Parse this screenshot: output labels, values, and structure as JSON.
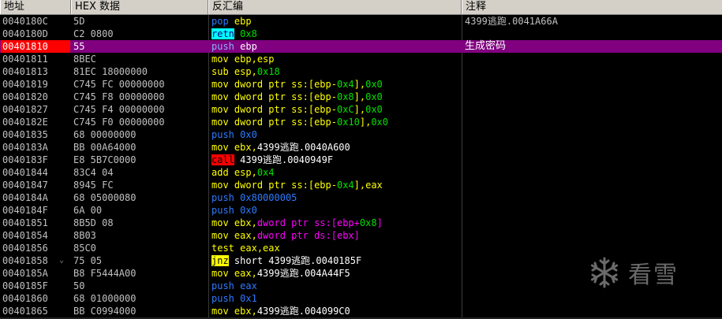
{
  "header": {
    "address": "地址",
    "hex": "HEX 数据",
    "disassembly": "反汇编",
    "comment": "注释"
  },
  "rows": [
    {
      "addr": "0040180C",
      "hex": "5D",
      "mn": "pop",
      "ops": [
        {
          "t": "ebp",
          "c": "op-y"
        }
      ],
      "cmt": "4399逃跑.0041A66A"
    },
    {
      "addr": "0040180D",
      "hex": "C2 0800",
      "mn": "retn",
      "ops": [
        {
          "t": "0x8",
          "c": "op-g"
        }
      ],
      "cmt": ""
    },
    {
      "addr": "00401810",
      "hex": "55",
      "mn": "push",
      "ops": [
        {
          "t": "ebp",
          "c": "op-w"
        }
      ],
      "cmt": "生成密码"
    },
    {
      "addr": "00401811",
      "hex": "8BEC",
      "mn": "mov",
      "ops": [
        {
          "t": "ebp,esp",
          "c": "op-y"
        }
      ],
      "cmt": ""
    },
    {
      "addr": "00401813",
      "hex": "81EC 18000000",
      "mn": "sub",
      "ops": [
        {
          "t": "esp,",
          "c": "op-y"
        },
        {
          "t": "0x18",
          "c": "op-g"
        }
      ],
      "cmt": ""
    },
    {
      "addr": "00401819",
      "hex": "C745 FC 00000000",
      "mn": "mov",
      "ops": [
        {
          "t": "dword ptr ss:[ebp-",
          "c": "op-y"
        },
        {
          "t": "0x4",
          "c": "op-g"
        },
        {
          "t": "],",
          "c": "op-y"
        },
        {
          "t": "0x0",
          "c": "op-g"
        }
      ],
      "cmt": ""
    },
    {
      "addr": "00401820",
      "hex": "C745 F8 00000000",
      "mn": "mov",
      "ops": [
        {
          "t": "dword ptr ss:[ebp-",
          "c": "op-y"
        },
        {
          "t": "0x8",
          "c": "op-g"
        },
        {
          "t": "],",
          "c": "op-y"
        },
        {
          "t": "0x0",
          "c": "op-g"
        }
      ],
      "cmt": ""
    },
    {
      "addr": "00401827",
      "hex": "C745 F4 00000000",
      "mn": "mov",
      "ops": [
        {
          "t": "dword ptr ss:[ebp-",
          "c": "op-y"
        },
        {
          "t": "0xC",
          "c": "op-g"
        },
        {
          "t": "],",
          "c": "op-y"
        },
        {
          "t": "0x0",
          "c": "op-g"
        }
      ],
      "cmt": ""
    },
    {
      "addr": "0040182E",
      "hex": "C745 F0 00000000",
      "mn": "mov",
      "ops": [
        {
          "t": "dword ptr ss:[ebp-",
          "c": "op-y"
        },
        {
          "t": "0x10",
          "c": "op-g"
        },
        {
          "t": "],",
          "c": "op-y"
        },
        {
          "t": "0x0",
          "c": "op-g"
        }
      ],
      "cmt": ""
    },
    {
      "addr": "00401835",
      "hex": "68 00000000",
      "mn": "push",
      "ops": [
        {
          "t": "0x0",
          "c": "op-b"
        }
      ],
      "cmt": ""
    },
    {
      "addr": "0040183A",
      "hex": "BB 00A64000",
      "mn": "mov",
      "ops": [
        {
          "t": "ebx,",
          "c": "op-y"
        },
        {
          "t": "4399逃跑.0040A600",
          "c": "op-w"
        }
      ],
      "cmt": ""
    },
    {
      "addr": "0040183F",
      "hex": "E8 5B7C0000",
      "mn": "call",
      "ops": [
        {
          "t": "4399逃跑.0040949F",
          "c": "op-w"
        }
      ],
      "cmt": ""
    },
    {
      "addr": "00401844",
      "hex": "83C4 04",
      "mn": "add",
      "ops": [
        {
          "t": "esp,",
          "c": "op-y"
        },
        {
          "t": "0x4",
          "c": "op-g"
        }
      ],
      "cmt": ""
    },
    {
      "addr": "00401847",
      "hex": "8945 FC",
      "mn": "mov",
      "ops": [
        {
          "t": "dword ptr ss:[ebp-",
          "c": "op-y"
        },
        {
          "t": "0x4",
          "c": "op-g"
        },
        {
          "t": "],eax",
          "c": "op-y"
        }
      ],
      "cmt": ""
    },
    {
      "addr": "0040184A",
      "hex": "68 05000080",
      "mn": "push",
      "ops": [
        {
          "t": "0x80000005",
          "c": "op-b"
        }
      ],
      "cmt": ""
    },
    {
      "addr": "0040184F",
      "hex": "6A 00",
      "mn": "push",
      "ops": [
        {
          "t": "0x0",
          "c": "op-b"
        }
      ],
      "cmt": ""
    },
    {
      "addr": "00401851",
      "hex": "8B5D 08",
      "mn": "mov",
      "ops": [
        {
          "t": "ebx,",
          "c": "op-y"
        },
        {
          "t": "dword ptr ss:[ebp+",
          "c": "op-m"
        },
        {
          "t": "0x8",
          "c": "op-g"
        },
        {
          "t": "]",
          "c": "op-m"
        }
      ],
      "cmt": ""
    },
    {
      "addr": "00401854",
      "hex": "8B03",
      "mn": "mov",
      "ops": [
        {
          "t": "eax,",
          "c": "op-y"
        },
        {
          "t": "dword ptr ds:[ebx]",
          "c": "op-m"
        }
      ],
      "cmt": ""
    },
    {
      "addr": "00401856",
      "hex": "85C0",
      "mn": "test",
      "ops": [
        {
          "t": "eax,eax",
          "c": "op-y"
        }
      ],
      "cmt": ""
    },
    {
      "addr": "00401858",
      "hex": "75 05",
      "mn": "jnz",
      "ops": [
        {
          "t": "short 4399逃跑.0040185F",
          "c": "op-w"
        }
      ],
      "cmt": ""
    },
    {
      "addr": "0040185A",
      "hex": "B8 F5444A00",
      "mn": "mov",
      "ops": [
        {
          "t": "eax,",
          "c": "op-y"
        },
        {
          "t": "4399逃跑.004A44F5",
          "c": "op-w"
        }
      ],
      "cmt": ""
    },
    {
      "addr": "0040185F",
      "hex": "50",
      "mn": "push",
      "ops": [
        {
          "t": "eax",
          "c": "op-b"
        }
      ],
      "cmt": ""
    },
    {
      "addr": "00401860",
      "hex": "68 01000000",
      "mn": "push",
      "ops": [
        {
          "t": "0x1",
          "c": "op-b"
        }
      ],
      "cmt": ""
    },
    {
      "addr": "00401865",
      "hex": "BB C0994000",
      "mn": "mov",
      "ops": [
        {
          "t": "ebx,",
          "c": "op-y"
        },
        {
          "t": "4399逃跑.004099C0",
          "c": "op-w"
        }
      ],
      "cmt": ""
    }
  ],
  "current_row": 2,
  "breakpoint_row": 2,
  "jump_marker_row": 19,
  "jump_marker": "⌄",
  "mnemonic_styles": {
    "pop": "mn-blue",
    "retn": "mn-hl-cyan",
    "push": "mn-blue",
    "mov": "mn-plain",
    "sub": "mn-plain",
    "call": "mn-hl-red",
    "add": "mn-plain",
    "test": "mn-plain",
    "jnz": "mn-hl-yellow"
  },
  "logo": {
    "text": "看雪",
    "icon": "snowflake-icon"
  }
}
